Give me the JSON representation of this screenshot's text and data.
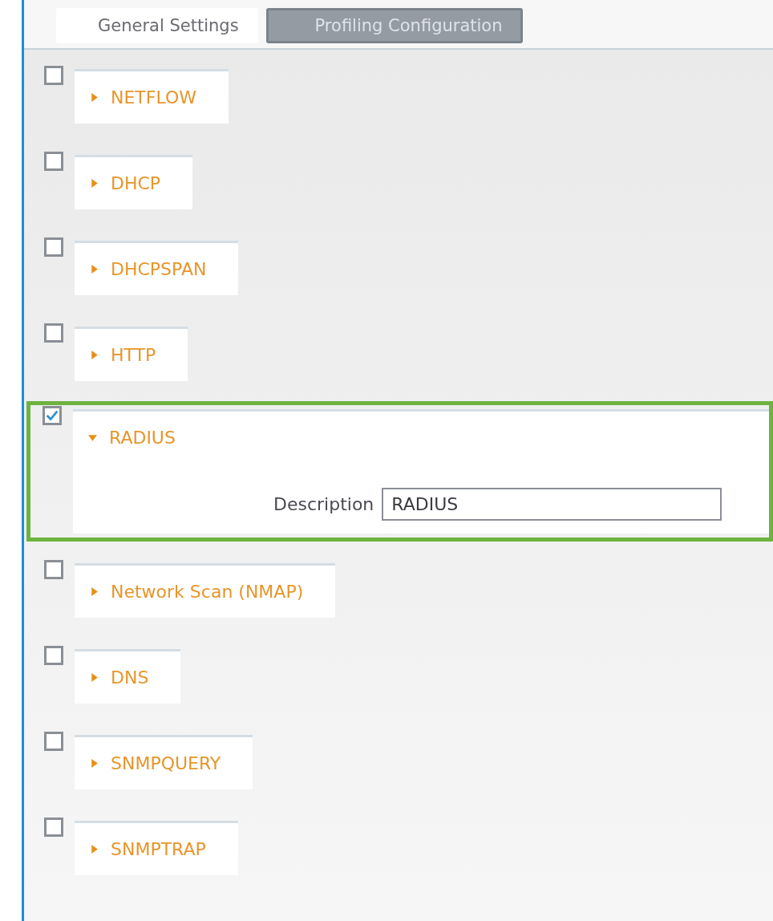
{
  "tabs": [
    {
      "label": "General Settings",
      "selected": false
    },
    {
      "label": "Profiling Configuration",
      "selected": true
    }
  ],
  "probes": [
    {
      "name": "NETFLOW",
      "checked": false,
      "expanded": false,
      "highlighted": false
    },
    {
      "name": "DHCP",
      "checked": false,
      "expanded": false,
      "highlighted": false
    },
    {
      "name": "DHCPSPAN",
      "checked": false,
      "expanded": false,
      "highlighted": false
    },
    {
      "name": "HTTP",
      "checked": false,
      "expanded": false,
      "highlighted": false
    },
    {
      "name": "RADIUS",
      "checked": true,
      "expanded": true,
      "highlighted": true,
      "fields": [
        {
          "label": "Description",
          "value": "RADIUS"
        }
      ]
    },
    {
      "name": "Network Scan (NMAP)",
      "checked": false,
      "expanded": false,
      "highlighted": false
    },
    {
      "name": "DNS",
      "checked": false,
      "expanded": false,
      "highlighted": false
    },
    {
      "name": "SNMPQUERY",
      "checked": false,
      "expanded": false,
      "highlighted": false
    },
    {
      "name": "SNMPTRAP",
      "checked": false,
      "expanded": false,
      "highlighted": false
    }
  ]
}
